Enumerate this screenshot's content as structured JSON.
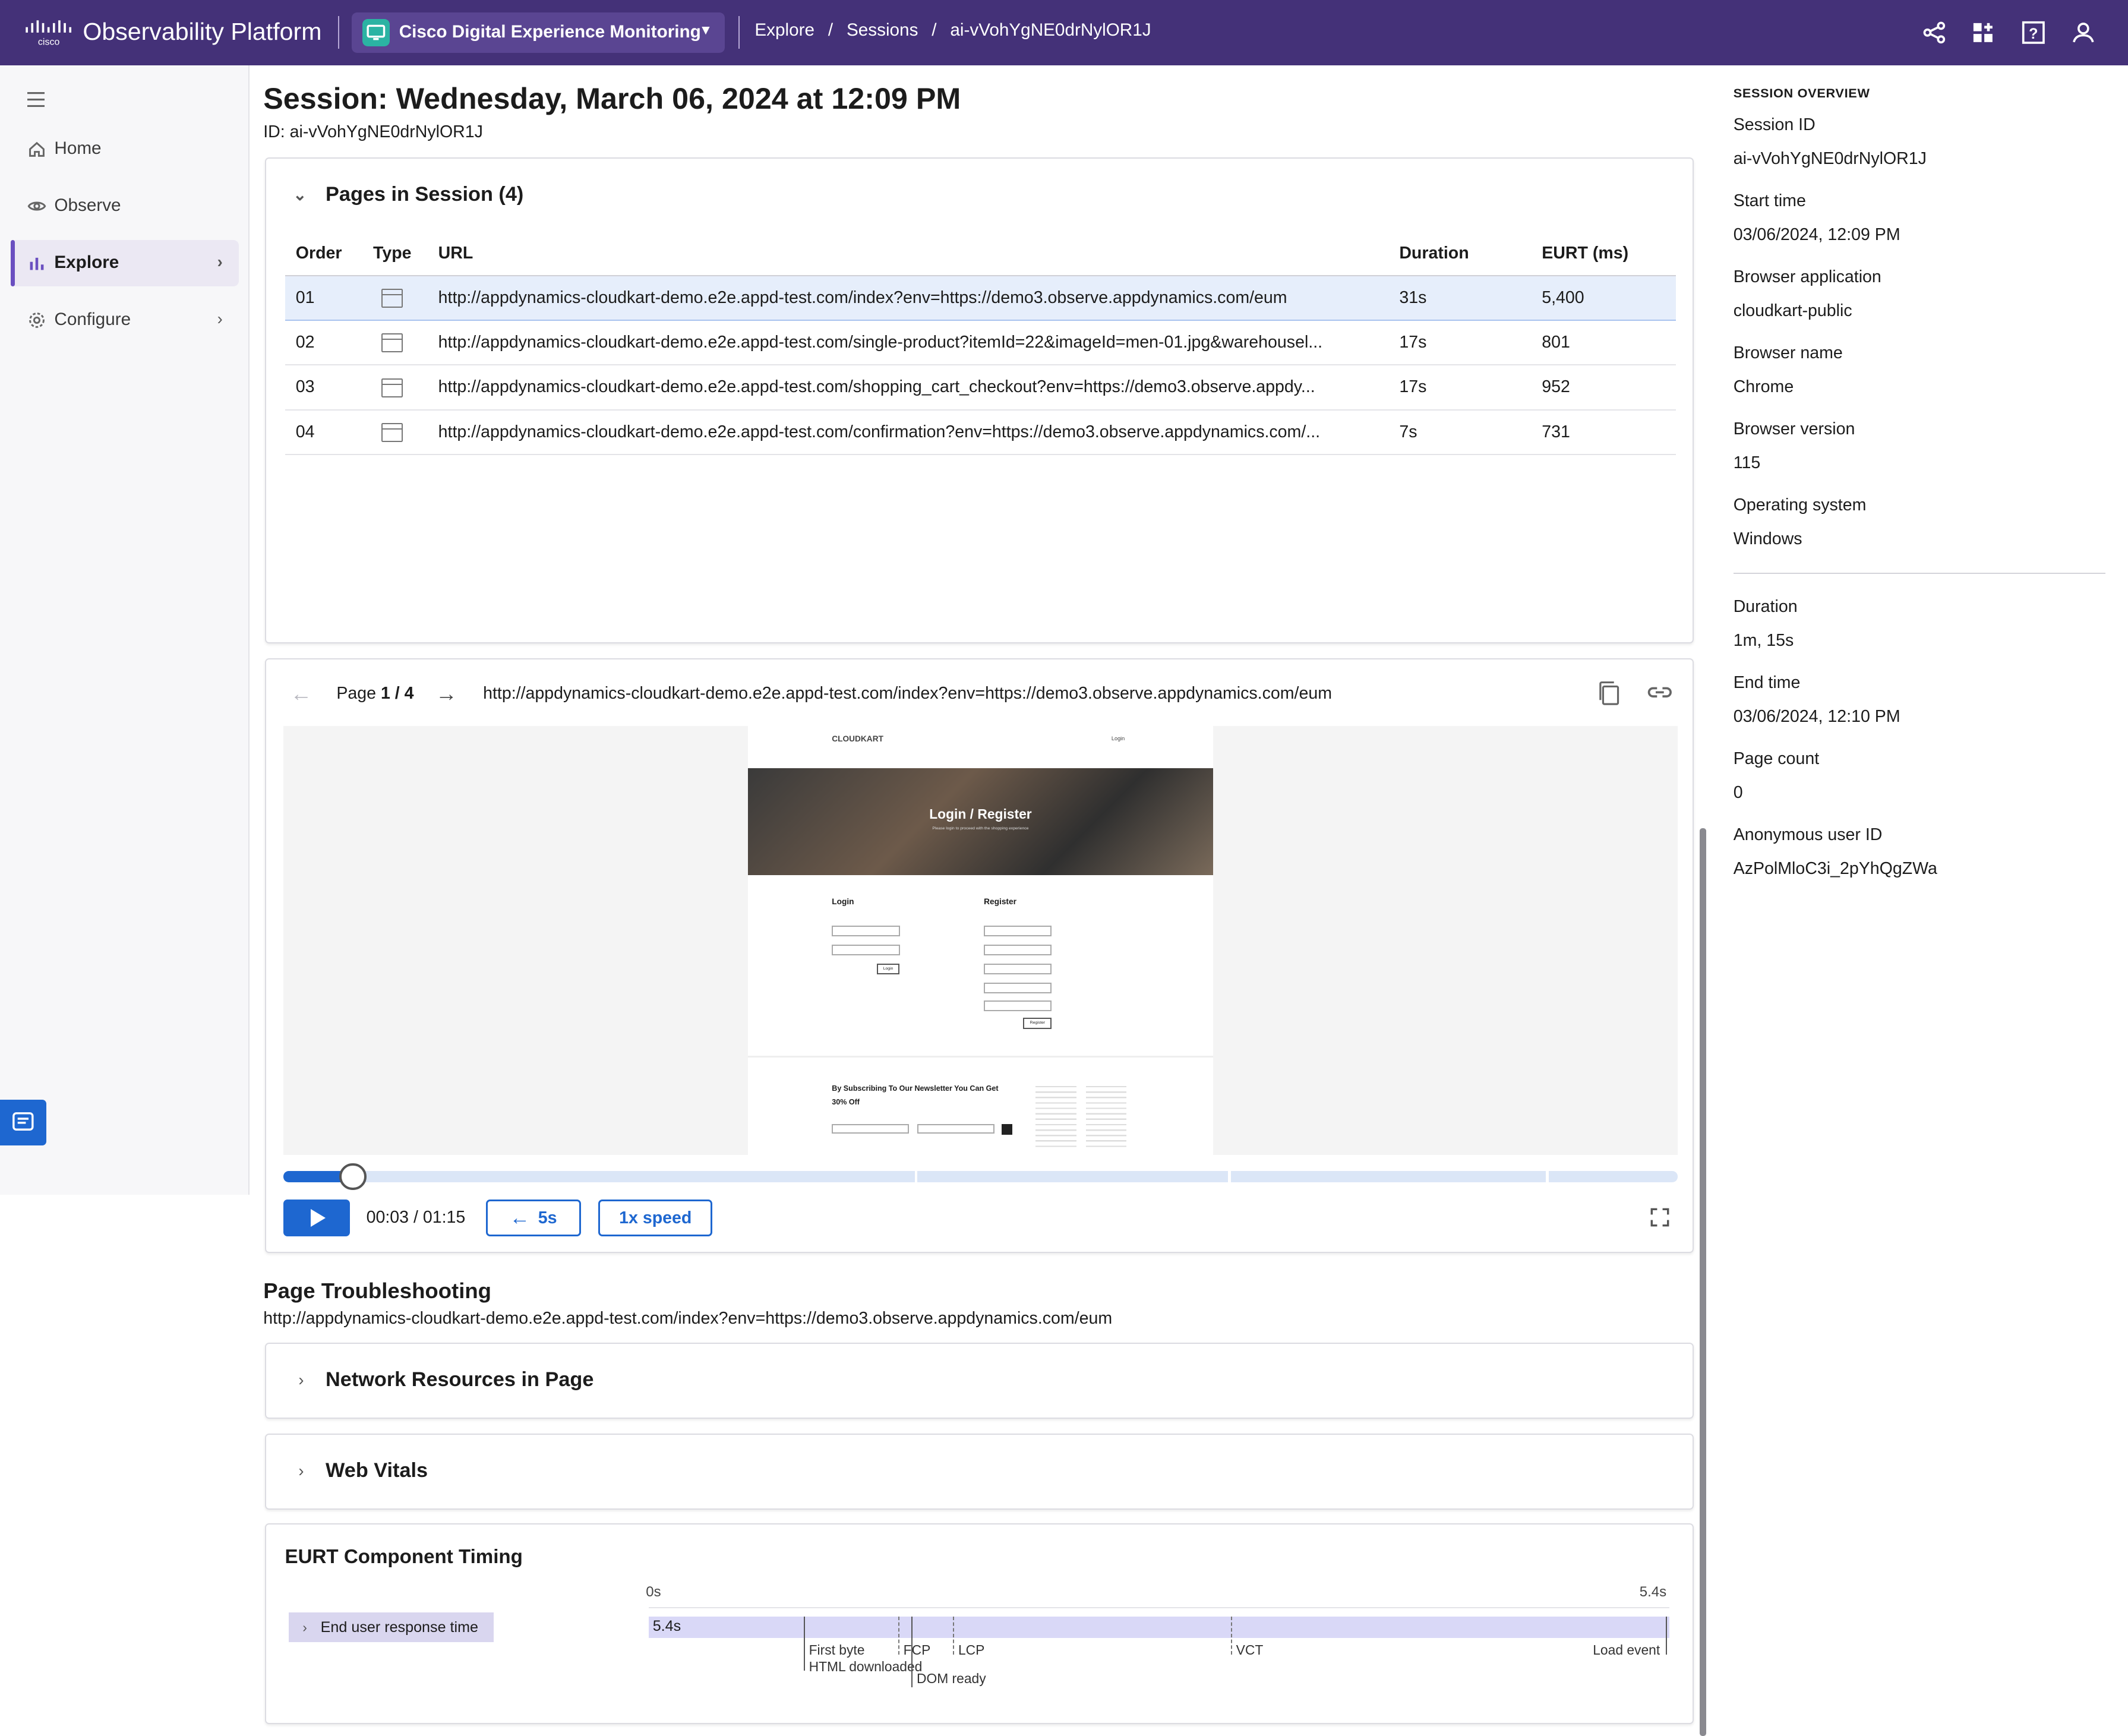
{
  "topbar": {
    "platform_name": "Observability Platform",
    "product_name": "Cisco Digital Experience Monitoring",
    "breadcrumb": [
      "Explore",
      "/",
      "Sessions",
      "/",
      "ai-vVohYgNE0drNylOR1J"
    ]
  },
  "sidebar": {
    "items": [
      {
        "label": "Home",
        "icon": "home-icon"
      },
      {
        "label": "Observe",
        "icon": "eye-icon"
      },
      {
        "label": "Explore",
        "icon": "bar-chart-icon"
      },
      {
        "label": "Configure",
        "icon": "gear-icon"
      }
    ]
  },
  "session": {
    "title": "Session: Wednesday, March 06, 2024 at 12:09 PM",
    "id_line": "ID: ai-vVohYgNE0drNylOR1J"
  },
  "pages": {
    "header": "Pages in Session (4)",
    "columns": [
      "Order",
      "Type",
      "URL",
      "Duration",
      "EURT (ms)"
    ],
    "rows": [
      {
        "order": "01",
        "url": "http://appdynamics-cloudkart-demo.e2e.appd-test.com/index?env=https://demo3.observe.appdynamics.com/eum",
        "duration": "31s",
        "eurt": "5,400"
      },
      {
        "order": "02",
        "url": "http://appdynamics-cloudkart-demo.e2e.appd-test.com/single-product?itemId=22&imageId=men-01.jpg&warehousel...",
        "duration": "17s",
        "eurt": "801"
      },
      {
        "order": "03",
        "url": "http://appdynamics-cloudkart-demo.e2e.appd-test.com/shopping_cart_checkout?env=https://demo3.observe.appdy...",
        "duration": "17s",
        "eurt": "952"
      },
      {
        "order": "04",
        "url": "http://appdynamics-cloudkart-demo.e2e.appd-test.com/confirmation?env=https://demo3.observe.appdynamics.com/...",
        "duration": "7s",
        "eurt": "731"
      }
    ]
  },
  "player": {
    "page_label": "Page",
    "page_current": "1 / 4",
    "url": "http://appdynamics-cloudkart-demo.e2e.appd-test.com/index?env=https://demo3.observe.appdynamics.com/eum",
    "time": "00:03 / 01:15",
    "rewind_label": "5s",
    "speed_label": "1x speed",
    "progress": 0.04,
    "replay": {
      "brand": "CLOUDKART",
      "login_link": "Login",
      "hero": "Login / Register",
      "hero_sub": "Please login to proceed with the shopping experience",
      "login_heading": "Login",
      "register_heading": "Register",
      "login_button": "Login",
      "register_button": "Register",
      "newsletter": "By Subscribing To Our Newsletter You Can Get 30% Off"
    }
  },
  "troubleshooting": {
    "title": "Page Troubleshooting",
    "url": "http://appdynamics-cloudkart-demo.e2e.appd-test.com/index?env=https://demo3.observe.appdynamics.com/eum",
    "sections": [
      "Network Resources in Page",
      "Web Vitals"
    ]
  },
  "eurt": {
    "title": "EURT Component Timing",
    "row_label": "End user response time",
    "axis_start": "0s",
    "axis_end": "5.4s",
    "bar_label": "5.4s",
    "markers": [
      {
        "label": "First byte",
        "label2": "HTML downloaded",
        "t": 0.82
      },
      {
        "label": "FCP",
        "t": 1.32
      },
      {
        "label": "DOM ready",
        "t": 1.39
      },
      {
        "label": "LCP",
        "t": 1.61
      },
      {
        "label": "VCT",
        "t": 3.08
      },
      {
        "label": "Load event",
        "t": 5.38
      }
    ]
  },
  "overview": {
    "heading": "SESSION OVERVIEW",
    "fields": [
      {
        "label": "Session ID",
        "value": "ai-vVohYgNE0drNylOR1J"
      },
      {
        "label": "Start time",
        "value": "03/06/2024, 12:09 PM"
      },
      {
        "label": "Browser application",
        "value": "cloudkart-public"
      },
      {
        "label": "Browser name",
        "value": "Chrome"
      },
      {
        "label": "Browser version",
        "value": "115"
      },
      {
        "label": "Operating system",
        "value": "Windows"
      },
      {
        "label": "Duration",
        "value": "1m, 15s"
      },
      {
        "label": "End time",
        "value": "03/06/2024, 12:10 PM"
      },
      {
        "label": "Page count",
        "value": "0"
      },
      {
        "label": "Anonymous user ID",
        "value": "AzPolMloC3i_2pYhQgZWa"
      }
    ]
  }
}
